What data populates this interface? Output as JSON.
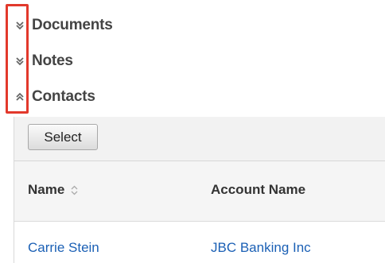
{
  "subpanels": [
    {
      "title": "Documents",
      "toggle_icon": "chevron-double-down-icon",
      "state": "collapsed"
    },
    {
      "title": "Notes",
      "toggle_icon": "chevron-double-down-icon",
      "state": "collapsed"
    },
    {
      "title": "Contacts",
      "toggle_icon": "chevron-double-up-icon",
      "state": "expanded"
    }
  ],
  "contacts_panel": {
    "select_button_label": "Select",
    "columns": [
      {
        "label": "Name",
        "sortable": true,
        "sort_icon": "sort-arrows-icon"
      },
      {
        "label": "Account Name",
        "sortable": false
      }
    ],
    "rows": [
      {
        "name": "Carrie Stein",
        "account_name": "JBC Banking Inc"
      }
    ]
  },
  "colors": {
    "highlight": "#e2392c",
    "link": "#1b60b5",
    "title": "#444444"
  }
}
